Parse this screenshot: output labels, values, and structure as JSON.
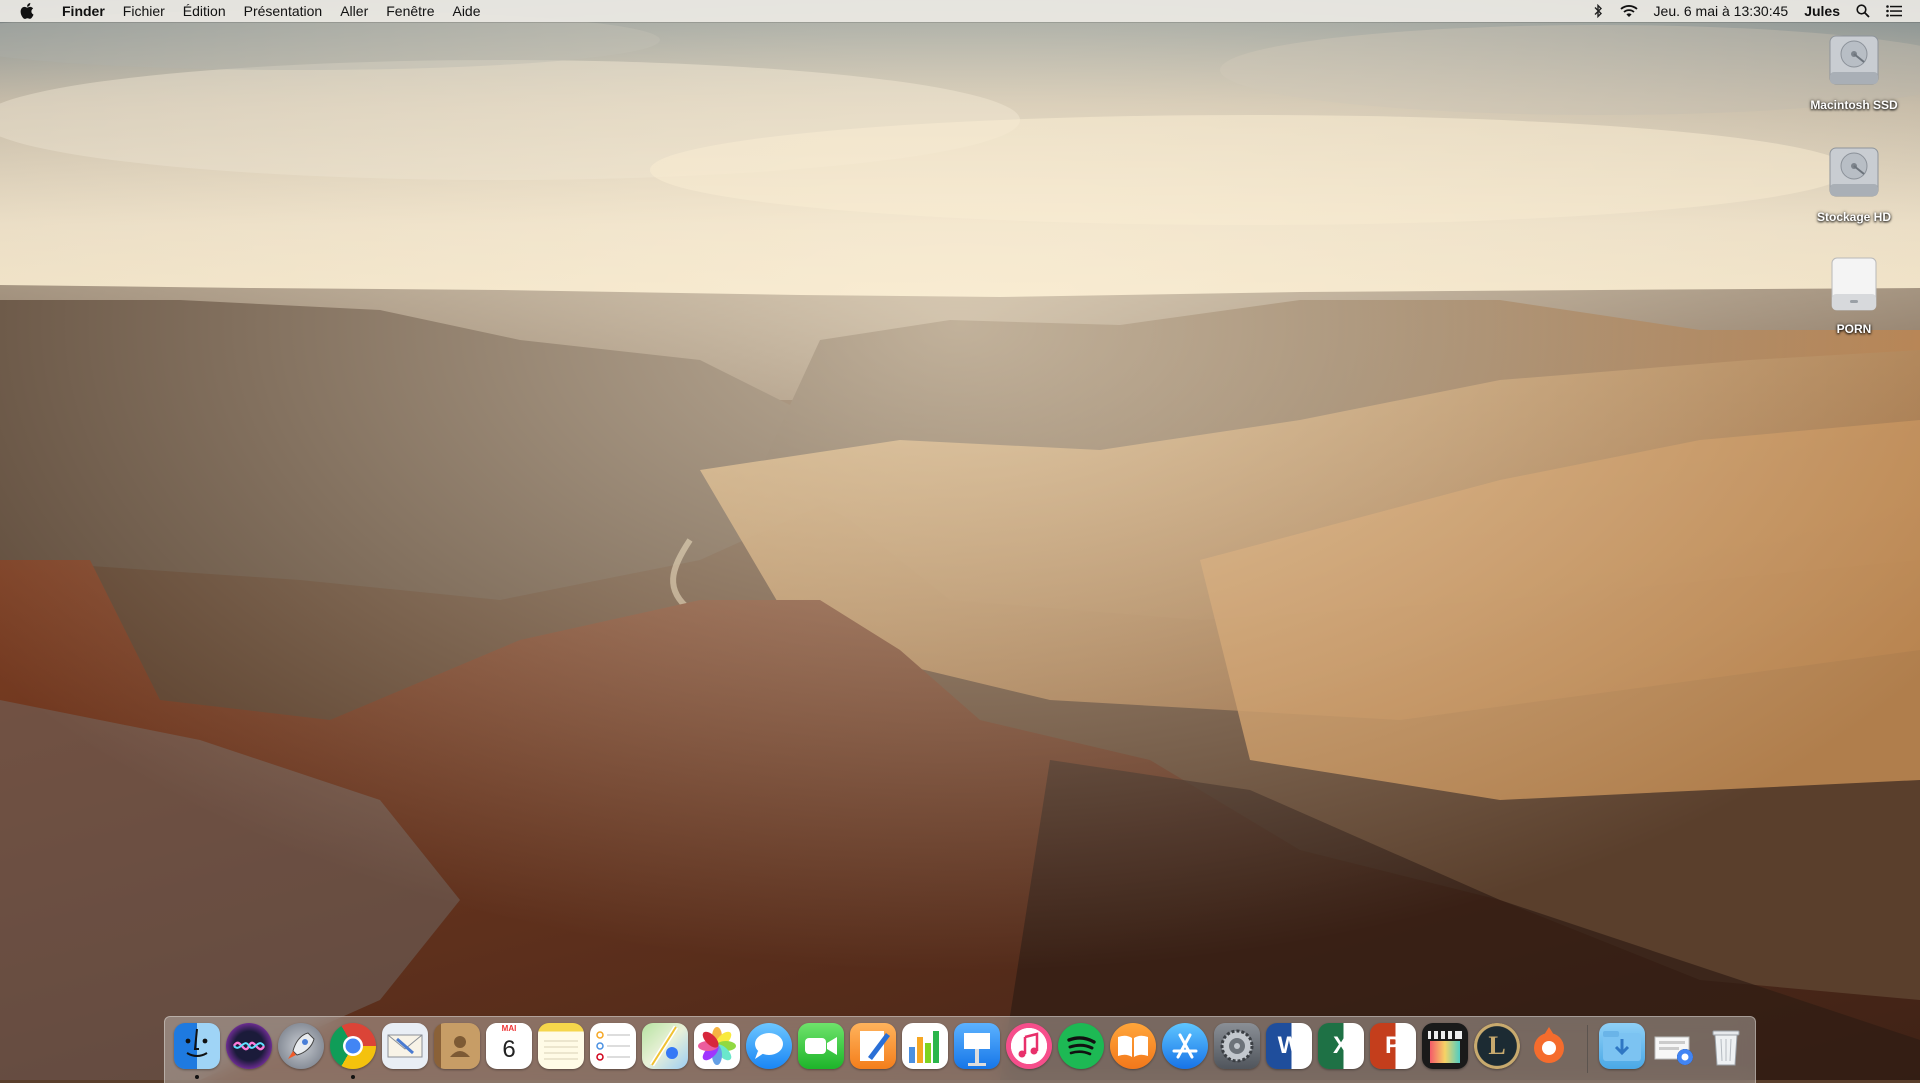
{
  "menubar": {
    "apple_icon": "apple-logo-icon",
    "app_name": "Finder",
    "menus": [
      "Fichier",
      "Édition",
      "Présentation",
      "Aller",
      "Fenêtre",
      "Aide"
    ],
    "status": {
      "bluetooth_icon": "bluetooth-icon",
      "wifi_icon": "wifi-icon",
      "clock": "Jeu. 6 mai à  13:30:45",
      "user": "Jules",
      "spotlight_icon": "search-icon",
      "notification_icon": "list-icon"
    }
  },
  "desktop": {
    "icons": [
      {
        "label": "Macintosh SSD",
        "icon": "internal-drive-icon"
      },
      {
        "label": "Stockage HD",
        "icon": "internal-drive-icon"
      },
      {
        "label": "PORN",
        "icon": "external-drive-icon"
      }
    ]
  },
  "dock": {
    "apps": [
      {
        "name": "Finder",
        "icon": "finder-icon",
        "running": true
      },
      {
        "name": "Siri",
        "icon": "siri-icon",
        "running": false
      },
      {
        "name": "Launchpad",
        "icon": "launchpad-icon",
        "running": false
      },
      {
        "name": "Google Chrome",
        "icon": "chrome-icon",
        "running": true
      },
      {
        "name": "Mail",
        "icon": "mail-icon",
        "running": false
      },
      {
        "name": "Contacts",
        "icon": "contacts-icon",
        "running": false
      },
      {
        "name": "Calendrier",
        "icon": "calendar-icon",
        "running": false,
        "month": "MAI",
        "day": "6"
      },
      {
        "name": "Notes",
        "icon": "notes-icon",
        "running": false
      },
      {
        "name": "Rappels",
        "icon": "reminders-icon",
        "running": false
      },
      {
        "name": "Plans",
        "icon": "maps-icon",
        "running": false
      },
      {
        "name": "Photos",
        "icon": "photos-icon",
        "running": false
      },
      {
        "name": "Messages",
        "icon": "messages-icon",
        "running": false
      },
      {
        "name": "FaceTime",
        "icon": "facetime-icon",
        "running": false
      },
      {
        "name": "Pages",
        "icon": "pages-icon",
        "running": false
      },
      {
        "name": "Numbers",
        "icon": "numbers-icon",
        "running": false
      },
      {
        "name": "Keynote",
        "icon": "keynote-icon",
        "running": false
      },
      {
        "name": "iTunes",
        "icon": "itunes-icon",
        "running": false
      },
      {
        "name": "Spotify",
        "icon": "spotify-icon",
        "running": false
      },
      {
        "name": "iBooks",
        "icon": "ibooks-icon",
        "running": false
      },
      {
        "name": "App Store",
        "icon": "app-store-icon",
        "running": false
      },
      {
        "name": "Préférences Système",
        "icon": "system-preferences-icon",
        "running": false
      },
      {
        "name": "Microsoft Word",
        "icon": "word-icon",
        "running": false,
        "letter": "W"
      },
      {
        "name": "Microsoft Excel",
        "icon": "excel-icon",
        "running": false,
        "letter": "X"
      },
      {
        "name": "Microsoft PowerPoint",
        "icon": "powerpoint-icon",
        "running": false,
        "letter": "P"
      },
      {
        "name": "Final Cut Pro",
        "icon": "final-cut-pro-icon",
        "running": false
      },
      {
        "name": "League of Legends",
        "icon": "league-of-legends-icon",
        "running": false,
        "letter": "L"
      },
      {
        "name": "Origin",
        "icon": "origin-icon",
        "running": false
      }
    ],
    "stacks": [
      {
        "name": "Téléchargements",
        "icon": "downloads-folder-icon"
      },
      {
        "name": "Documents récents",
        "icon": "recent-documents-icon"
      }
    ],
    "trash": {
      "name": "Corbeille",
      "icon": "trash-icon"
    }
  }
}
